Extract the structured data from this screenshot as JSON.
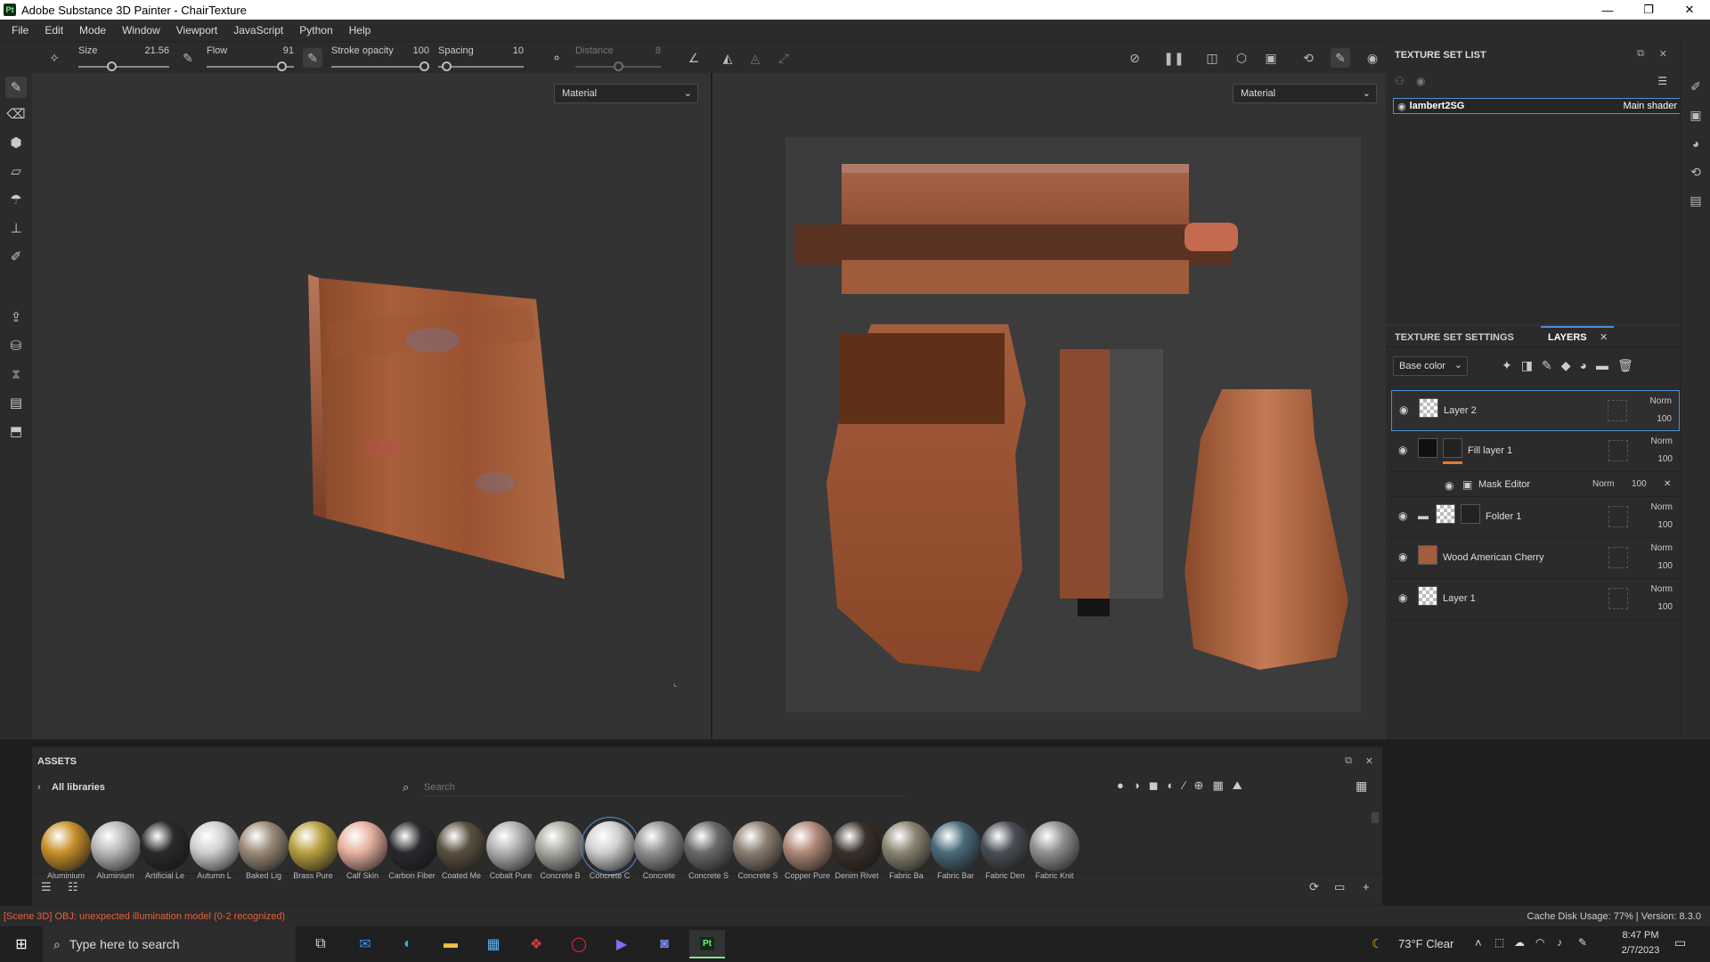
{
  "app": {
    "title": "Adobe Substance 3D Painter - ChairTexture",
    "logo": "Pt"
  },
  "menu": [
    "File",
    "Edit",
    "Mode",
    "Window",
    "Viewport",
    "JavaScript",
    "Python",
    "Help"
  ],
  "toolbar": {
    "size": {
      "label": "Size",
      "value": "21.56",
      "fraction": 0.35
    },
    "flow": {
      "label": "Flow",
      "value": "91",
      "fraction": 0.91
    },
    "stroke_opacity": {
      "label": "Stroke opacity",
      "value": "100",
      "fraction": 1.0
    },
    "spacing": {
      "label": "Spacing",
      "value": "10",
      "fraction": 0.05
    },
    "distance": {
      "label": "Distance",
      "value": "8",
      "fraction": 0.5
    }
  },
  "viewport": {
    "left_mode": "Material",
    "right_mode": "Material"
  },
  "texture_set_list": {
    "title": "TEXTURE SET LIST",
    "item": "lambert2SG",
    "shader": "Main shader"
  },
  "layers_panel": {
    "tabs": [
      "TEXTURE SET SETTINGS",
      "LAYERS"
    ],
    "channel": "Base color",
    "layers": [
      {
        "name": "Layer 2",
        "blend": "Norm",
        "opacity": "100"
      },
      {
        "name": "Fill layer 1",
        "blend": "Norm",
        "opacity": "100"
      },
      {
        "name": "Mask Editor",
        "blend": "Norm",
        "opacity": "100"
      },
      {
        "name": "Folder 1",
        "blend": "Norm",
        "opacity": "100"
      },
      {
        "name": "Wood American Cherry",
        "blend": "Norm",
        "opacity": "100"
      },
      {
        "name": "Layer 1",
        "blend": "Norm",
        "opacity": "100"
      }
    ]
  },
  "assets": {
    "title": "ASSETS",
    "library": "All libraries",
    "search_placeholder": "Search",
    "materials": [
      {
        "name": "Aluminium",
        "color": "#c8902a"
      },
      {
        "name": "Aluminium",
        "color": "#b8b8b8"
      },
      {
        "name": "Artificial Le",
        "color": "#2a2a2a"
      },
      {
        "name": "Autumn L",
        "color": "#d0d0d0"
      },
      {
        "name": "Baked Lig",
        "color": "#9a8a78"
      },
      {
        "name": "Brass Pure",
        "color": "#b8a040"
      },
      {
        "name": "Calf Skin",
        "color": "#e8b0a0"
      },
      {
        "name": "Carbon Fiber",
        "color": "#2a2a2e"
      },
      {
        "name": "Coated Me",
        "color": "#5a5040"
      },
      {
        "name": "Cobalt Pure",
        "color": "#b0b0b0"
      },
      {
        "name": "Concrete B",
        "color": "#a8a8a0"
      },
      {
        "name": "Concrete C",
        "color": "#cfcfcf"
      },
      {
        "name": "Concrete",
        "color": "#909090"
      },
      {
        "name": "Concrete S",
        "color": "#6a6a6a"
      },
      {
        "name": "Concrete S",
        "color": "#8a7e70"
      },
      {
        "name": "Copper Pure",
        "color": "#b08878"
      },
      {
        "name": "Denim Rivet",
        "color": "#3a302a"
      },
      {
        "name": "Fabric Ba",
        "color": "#8a8470"
      },
      {
        "name": "Fabric Bar",
        "color": "#4a6a7a"
      },
      {
        "name": "Fabric Den",
        "color": "#4a4e54"
      },
      {
        "name": "Fabric Knit",
        "color": "#909090"
      }
    ]
  },
  "status": {
    "message": "[Scene 3D] OBJ: unexpected illumination model (0-2 recognized)",
    "cache": "Cache Disk Usage:  77% | Version: 8.3.0"
  },
  "taskbar": {
    "search_placeholder": "Type here to search",
    "weather": "73°F  Clear",
    "time": "8:47 PM",
    "date": "2/7/2023"
  }
}
